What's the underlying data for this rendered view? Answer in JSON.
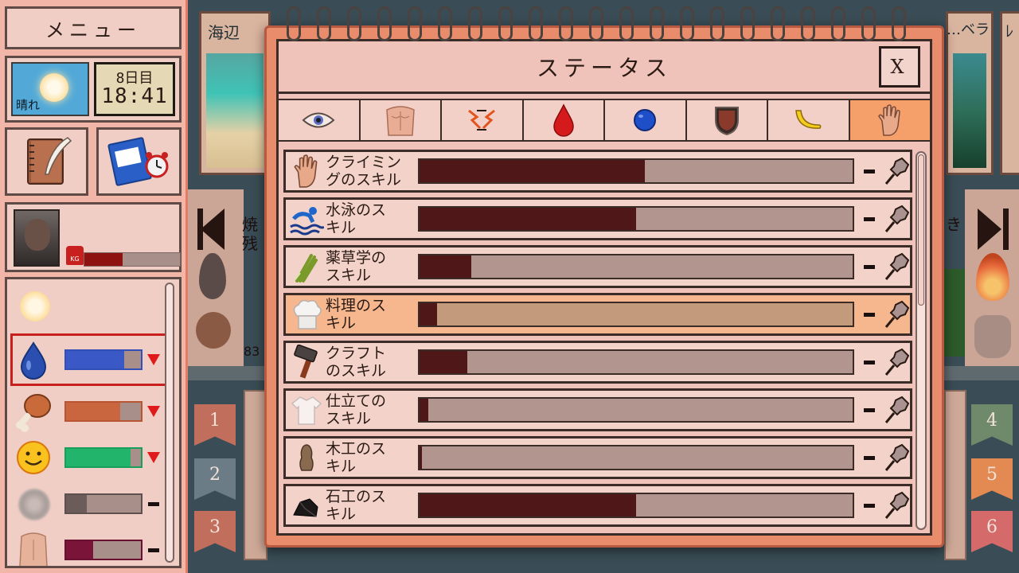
{
  "sidebar": {
    "menu_label": "メニュー",
    "weather_label": "晴れ",
    "day_label": "8日目",
    "time_label": "18:41",
    "weight_badge": "KG",
    "weight_level": 0.4,
    "needs": [
      {
        "icon": "sun-icon"
      },
      {
        "icon": "water-drop-icon",
        "level": 0.78,
        "color": "#3a58c6",
        "border": "#3350b8",
        "trend": "down"
      },
      {
        "icon": "drumstick-icon",
        "level": 0.72,
        "color": "#c9653f",
        "border": "#b85634",
        "trend": "down"
      },
      {
        "icon": "smiley-icon",
        "level": 0.86,
        "color": "#23b46b",
        "border": "#17a05c",
        "trend": "down"
      },
      {
        "icon": "dirt-icon",
        "level": 0.28,
        "color": "#6b5c59",
        "border": "#5e504e",
        "trend": "flat"
      },
      {
        "icon": "body-icon",
        "level": 0.36,
        "color": "#7a1438",
        "border": "#6a1030",
        "trend": "flat"
      }
    ]
  },
  "background": {
    "card_labels": [
      "海辺",
      "…ベラ",
      "ﾚ"
    ],
    "side_text_left": [
      "焼",
      "残"
    ],
    "side_text_right": "き",
    "count_text": "83",
    "ribbons_left": [
      "1",
      "2",
      "3"
    ],
    "ribbons_right": [
      "4",
      "5",
      "6"
    ]
  },
  "dialog": {
    "title": "ステータス",
    "close_label": "X",
    "tabs": [
      {
        "icon": "eye-icon"
      },
      {
        "icon": "torso-icon"
      },
      {
        "icon": "nerves-icon"
      },
      {
        "icon": "blood-drop-icon"
      },
      {
        "icon": "blue-orb-icon"
      },
      {
        "icon": "shield-icon"
      },
      {
        "icon": "banana-icon"
      },
      {
        "icon": "hand-icon",
        "active": true
      }
    ],
    "skills": [
      {
        "line1": "クライミン",
        "line2": "グのスキル",
        "icon": "hand-icon",
        "level": 0.52
      },
      {
        "line1": "水泳のス",
        "line2": "キル",
        "icon": "swimmer-icon",
        "level": 0.5
      },
      {
        "line1": "薬草学の",
        "line2": "スキル",
        "icon": "herb-icon",
        "level": 0.12
      },
      {
        "line1": "料理のス",
        "line2": "キル",
        "icon": "chef-hat-icon",
        "level": 0.04,
        "highlight": true
      },
      {
        "line1": "クラフト",
        "line2": "のスキル",
        "icon": "hammer-icon",
        "level": 0.11
      },
      {
        "line1": "仕立ての",
        "line2": "スキル",
        "icon": "shirt-icon",
        "level": 0.02
      },
      {
        "line1": "木工のス",
        "line2": "キル",
        "icon": "woodcarving-icon",
        "level": 0.005
      },
      {
        "line1": "石工のス",
        "line2": "キル",
        "icon": "stone-icon",
        "level": 0.5
      }
    ]
  }
}
